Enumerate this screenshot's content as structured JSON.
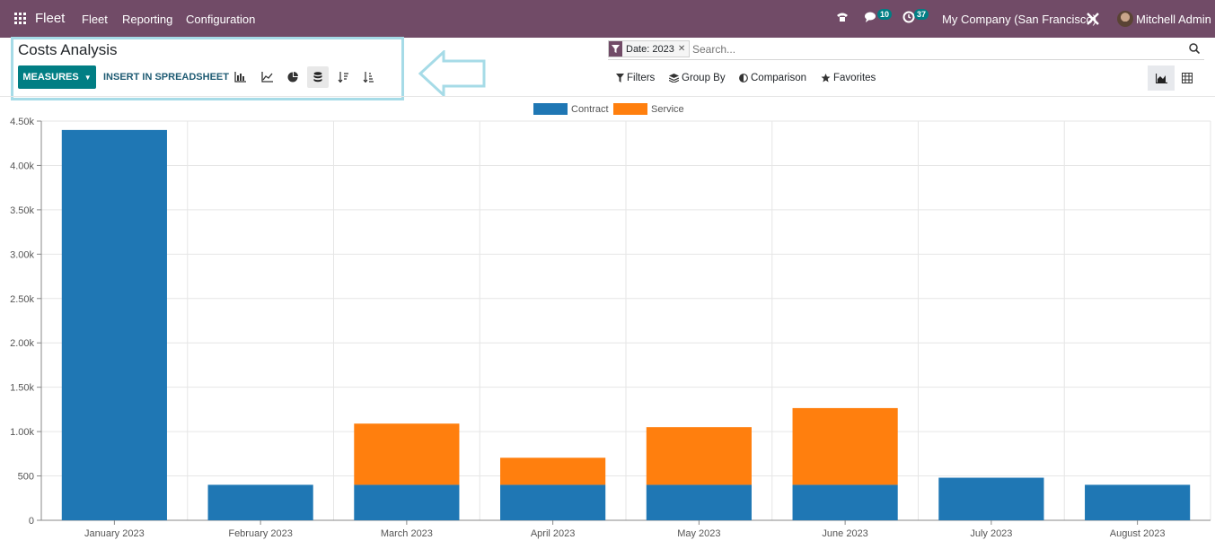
{
  "navbar": {
    "brand": "Fleet",
    "menu": [
      "Fleet",
      "Reporting",
      "Configuration"
    ],
    "messages_count": "10",
    "activities_count": "37",
    "company": "My Company (San Francisco)",
    "user": "Mitchell Admin"
  },
  "control_panel": {
    "title": "Costs Analysis",
    "measures_label": "MEASURES",
    "insert_label": "INSERT IN SPREADSHEET"
  },
  "search": {
    "facet_label": "Date: 2023",
    "placeholder": "Search...",
    "filters_label": "Filters",
    "group_by_label": "Group By",
    "comparison_label": "Comparison",
    "favorites_label": "Favorites"
  },
  "colors": {
    "navbar": "#714b67",
    "primary": "#017e84",
    "contract": "#1f77b4",
    "service": "#ff7f0e",
    "highlight": "#a6dbe7"
  },
  "chart_data": {
    "type": "bar",
    "stacked": true,
    "categories": [
      "January 2023",
      "February 2023",
      "March 2023",
      "April 2023",
      "May 2023",
      "June 2023",
      "July 2023",
      "August 2023"
    ],
    "series": [
      {
        "name": "Contract",
        "values": [
          4400,
          400,
          400,
          400,
          400,
          400,
          480,
          400
        ]
      },
      {
        "name": "Service",
        "values": [
          0,
          0,
          690,
          305,
          650,
          865,
          0,
          0
        ]
      }
    ],
    "ylim": [
      0,
      4500
    ],
    "yticks": [
      0,
      500,
      1000,
      1500,
      2000,
      2500,
      3000,
      3500,
      4000,
      4500
    ],
    "ytick_labels": [
      "0",
      "500",
      "1.00k",
      "1.50k",
      "2.00k",
      "2.50k",
      "3.00k",
      "3.50k",
      "4.00k",
      "4.50k"
    ],
    "legend_position": "top-center",
    "grid": true
  }
}
